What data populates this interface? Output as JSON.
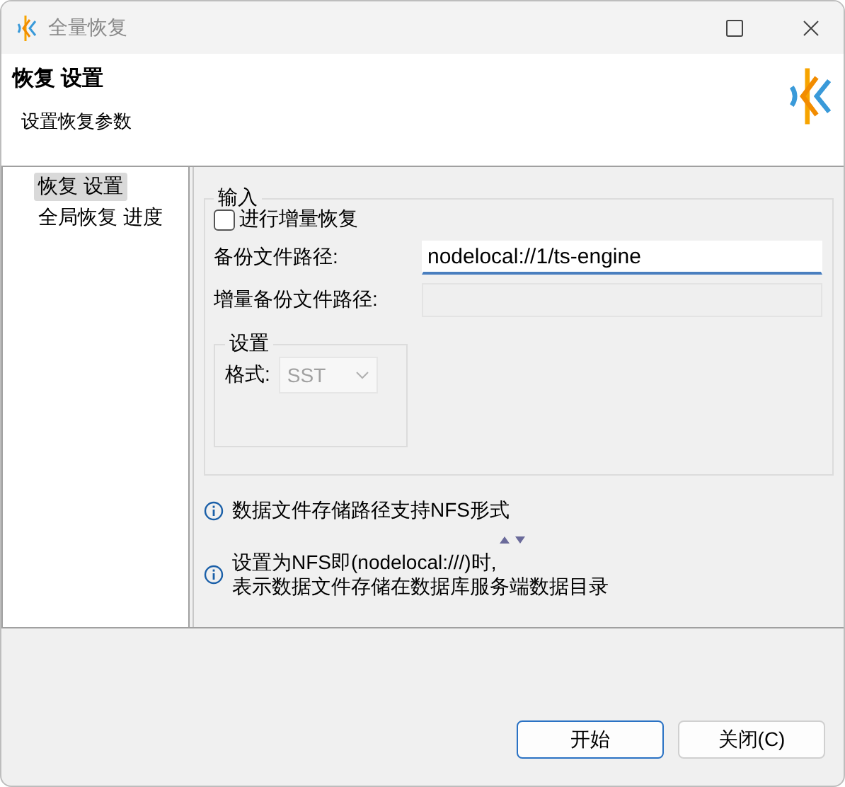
{
  "window": {
    "title": "全量恢复"
  },
  "header": {
    "title": "恢复 设置",
    "subtitle": "设置恢复参数"
  },
  "tree": {
    "items": [
      {
        "label": "恢复 设置",
        "selected": true
      },
      {
        "label": "全局恢复 进度",
        "selected": false
      }
    ]
  },
  "input_group": {
    "title": "输入",
    "checkbox": {
      "label": "进行增量恢复",
      "checked": false
    },
    "fields": [
      {
        "label": "备份文件路径:",
        "value": "nodelocal://1/ts-engine",
        "disabled": false,
        "focused": true
      },
      {
        "label": "增量备份文件路径:",
        "disabled": true,
        "focused": false
      }
    ],
    "settings": {
      "title": "设置",
      "format": {
        "label": "格式:",
        "value": "SST",
        "disabled": true
      }
    }
  },
  "notes": [
    {
      "lines": [
        "数据文件存储路径支持NFS形式"
      ]
    },
    {
      "lines": [
        "设置为NFS即(nodelocal:///)时,",
        "表示数据文件存储在数据库服务端数据目录"
      ]
    }
  ],
  "buttons": [
    {
      "label": "开始",
      "default": true
    },
    {
      "label": "关闭(C)",
      "default": false
    }
  ]
}
